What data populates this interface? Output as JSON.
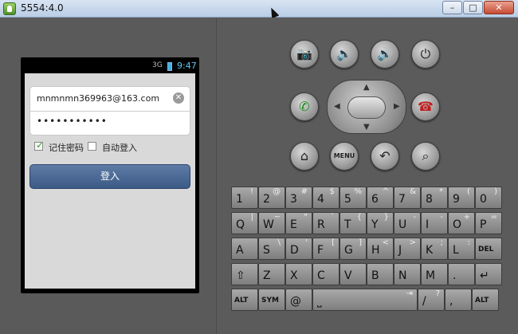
{
  "window": {
    "title": "5554:4.0",
    "minimize": "–",
    "maximize": "□",
    "close": "✕"
  },
  "phone": {
    "status": {
      "network": "3G",
      "time": "9:47"
    },
    "form": {
      "username": "mnmnmn369963@163.com",
      "password": "•••••••••••",
      "clear_icon": "✕",
      "remember_label": "记住密码",
      "remember_checked": true,
      "autologin_label": "自动登入",
      "autologin_checked": false,
      "login_button": "登入"
    }
  },
  "controls": {
    "camera": "camera-icon",
    "volume_down": "volume-down-icon",
    "volume_up": "volume-up-icon",
    "power": "power-icon",
    "call": "call-icon",
    "end_call": "end-call-icon",
    "home": "home-icon",
    "menu_label": "MENU",
    "back": "back-icon",
    "search": "search-icon"
  },
  "keyboard": {
    "rows": [
      [
        {
          "m": "1",
          "a": "!"
        },
        {
          "m": "2",
          "a": "@"
        },
        {
          "m": "3",
          "a": "#"
        },
        {
          "m": "4",
          "a": "$"
        },
        {
          "m": "5",
          "a": "%"
        },
        {
          "m": "6",
          "a": "^"
        },
        {
          "m": "7",
          "a": "&"
        },
        {
          "m": "8",
          "a": "*"
        },
        {
          "m": "9",
          "a": "("
        },
        {
          "m": "0",
          "a": ")"
        }
      ],
      [
        {
          "m": "Q",
          "a": "|"
        },
        {
          "m": "W",
          "a": "~"
        },
        {
          "m": "E",
          "a": "\""
        },
        {
          "m": "R",
          "a": "`"
        },
        {
          "m": "T",
          "a": "{"
        },
        {
          "m": "Y",
          "a": "}"
        },
        {
          "m": "U",
          "a": "-"
        },
        {
          "m": "I",
          "a": "-"
        },
        {
          "m": "O",
          "a": "+"
        },
        {
          "m": "P",
          "a": "="
        }
      ],
      [
        {
          "m": "A",
          "a": ""
        },
        {
          "m": "S",
          "a": "\\"
        },
        {
          "m": "D",
          "a": "'"
        },
        {
          "m": "F",
          "a": "["
        },
        {
          "m": "G",
          "a": "]"
        },
        {
          "m": "H",
          "a": "<"
        },
        {
          "m": "J",
          "a": ">"
        },
        {
          "m": "K",
          "a": ";"
        },
        {
          "m": "L",
          "a": ":"
        },
        {
          "m": "DEL",
          "a": ""
        }
      ],
      [
        {
          "m": "⇧",
          "a": ""
        },
        {
          "m": "Z",
          "a": ""
        },
        {
          "m": "X",
          "a": ""
        },
        {
          "m": "C",
          "a": ""
        },
        {
          "m": "V",
          "a": ""
        },
        {
          "m": "B",
          "a": ""
        },
        {
          "m": "N",
          "a": ""
        },
        {
          "m": "M",
          "a": ""
        },
        {
          "m": ".",
          "a": ""
        },
        {
          "m": "↵",
          "a": ""
        }
      ],
      [
        {
          "m": "ALT",
          "a": ""
        },
        {
          "m": "SYM",
          "a": ""
        },
        {
          "m": "@",
          "a": ""
        },
        {
          "m": "⎵",
          "a": "⇥"
        },
        {
          "m": "/",
          "a": "?"
        },
        {
          "m": ",",
          "a": ""
        },
        {
          "m": "ALT",
          "a": ""
        }
      ]
    ]
  }
}
